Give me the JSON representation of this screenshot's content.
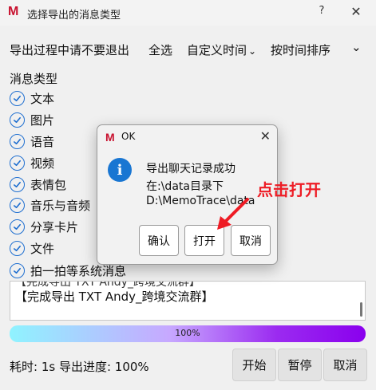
{
  "window": {
    "logo": "M",
    "title": "选择导出的消息类型",
    "help": "?",
    "close": "✕"
  },
  "toolbar": {
    "notice": "导出过程中请不要退出",
    "select_all": "全选",
    "time_mode": "自定义时间",
    "sort": "按时间排序"
  },
  "types": {
    "label": "消息类型",
    "items": [
      "文本",
      "图片",
      "语音",
      "视频",
      "表情包",
      "音乐与音频",
      "分享卡片",
      "文件",
      "拍一拍等系统消息"
    ]
  },
  "log": {
    "partial_line": "【完成导出 TXT Andy_跨境交流群】",
    "line": "【完成导出 TXT Andy_跨境交流群】"
  },
  "progress": {
    "value": 100,
    "label": "100%"
  },
  "status": {
    "text": "耗时: 1s 导出进度: 100%"
  },
  "buttons": {
    "start": "开始",
    "pause": "暂停",
    "cancel": "取消"
  },
  "dialog": {
    "logo": "M",
    "title": "OK",
    "close": "✕",
    "icon": "i",
    "lines": [
      "导出聊天记录成功",
      "在:\\data目录下",
      "D:\\MemoTrace\\data"
    ],
    "confirm": "确认",
    "open": "打开",
    "cancel": "取消"
  },
  "annotation": {
    "text": "点击打开",
    "color": "#ee1c25"
  },
  "colors": {
    "accent": "#1f6fd0",
    "logo": "#c8102e",
    "info": "#1976d2"
  }
}
